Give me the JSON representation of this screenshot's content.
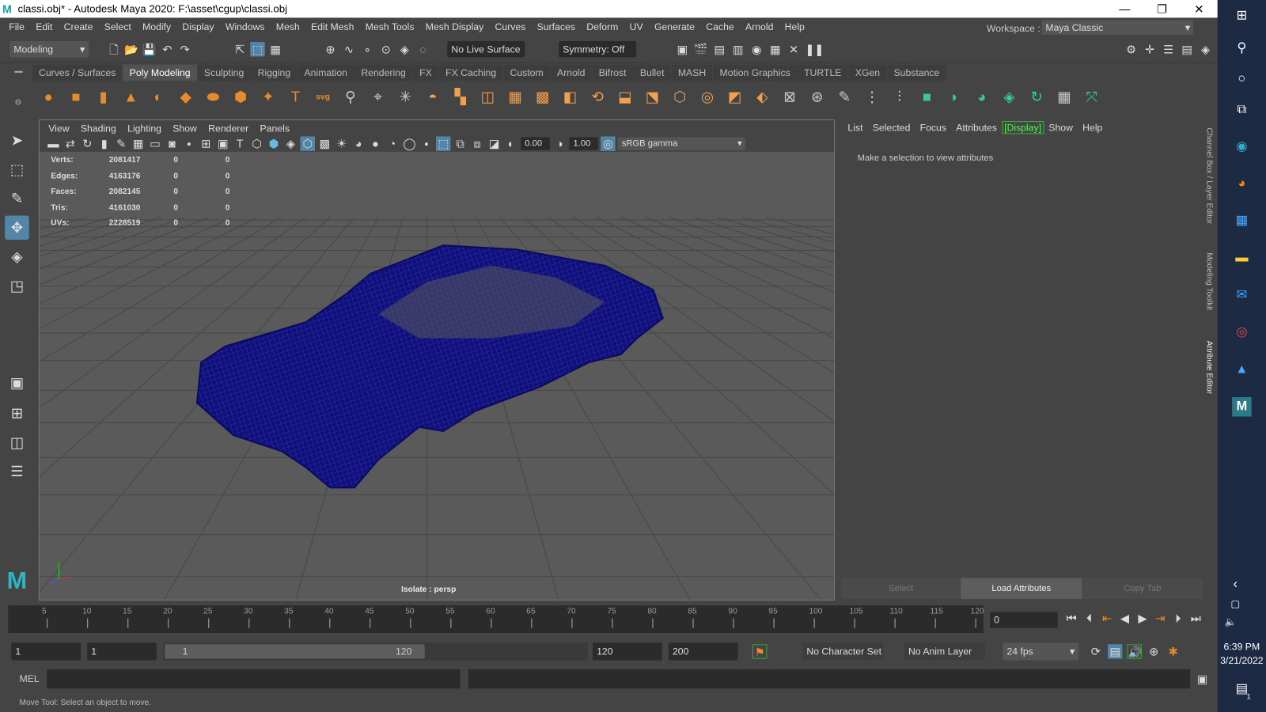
{
  "window": {
    "title": "classi.obj* - Autodesk Maya 2020: F:\\asset\\cgup\\classi.obj",
    "logo": "M",
    "minimize": "—",
    "maximize": "❐",
    "close": "✕"
  },
  "menubar": [
    "File",
    "Edit",
    "Create",
    "Select",
    "Modify",
    "Display",
    "Windows",
    "Mesh",
    "Edit Mesh",
    "Mesh Tools",
    "Mesh Display",
    "Curves",
    "Surfaces",
    "Deform",
    "UV",
    "Generate",
    "Cache",
    "Arnold",
    "Help"
  ],
  "statusline": {
    "menuset": "Modeling",
    "live_surface": "No Live Surface",
    "symmetry": "Symmetry: Off",
    "workspace_label": "Workspace :",
    "workspace": "Maya Classic"
  },
  "shelf_tabs": [
    "Curves / Surfaces",
    "Poly Modeling",
    "Sculpting",
    "Rigging",
    "Animation",
    "Rendering",
    "FX",
    "FX Caching",
    "Custom",
    "Arnold",
    "Bifrost",
    "Bullet",
    "MASH",
    "Motion Graphics",
    "TURTLE",
    "XGen",
    "Substance"
  ],
  "active_shelf_tab": "Poly Modeling",
  "viewport": {
    "menu": [
      "View",
      "Shading",
      "Lighting",
      "Show",
      "Renderer",
      "Panels"
    ],
    "exposure": "0.00",
    "gamma": "1.00",
    "colorspace": "sRGB gamma",
    "camera_label": "Isolate : persp",
    "stats": [
      {
        "label": "Verts:",
        "value": "2081417",
        "a": "0",
        "b": "0"
      },
      {
        "label": "Edges:",
        "value": "4163176",
        "a": "0",
        "b": "0"
      },
      {
        "label": "Faces:",
        "value": "2082145",
        "a": "0",
        "b": "0"
      },
      {
        "label": "Tris:",
        "value": "4161030",
        "a": "0",
        "b": "0"
      },
      {
        "label": "UVs:",
        "value": "2228519",
        "a": "0",
        "b": "0"
      }
    ]
  },
  "attribute_panel": {
    "menu": [
      "List",
      "Selected",
      "Focus",
      "Attributes",
      "[Display]",
      "Show",
      "Help"
    ],
    "message": "Make a selection to view attributes",
    "buttons": [
      "Select",
      "Load Attributes",
      "Copy Tab"
    ]
  },
  "side_tabs": [
    "Channel Box / Layer Editor",
    "Modeling Toolkit",
    "Attribute Editor"
  ],
  "timeline": {
    "ticks": [
      "5",
      "10",
      "15",
      "20",
      "25",
      "30",
      "35",
      "40",
      "45",
      "50",
      "55",
      "60",
      "65",
      "70",
      "75",
      "80",
      "85",
      "90",
      "95",
      "100",
      "105",
      "110",
      "115",
      "120"
    ],
    "current_frame": "0"
  },
  "range": {
    "start": "1",
    "playback_start": "1",
    "slider_start": "1",
    "slider_end": "120",
    "playback_end": "120",
    "end": "200",
    "character_set": "No Character Set",
    "anim_layer": "No Anim Layer",
    "fps": "24 fps"
  },
  "command": {
    "label": "MEL"
  },
  "help_line": "Move Tool: Select an object to move.",
  "taskbar": {
    "time": "6:39 PM",
    "date": "3/21/2022",
    "notifications": "1"
  }
}
